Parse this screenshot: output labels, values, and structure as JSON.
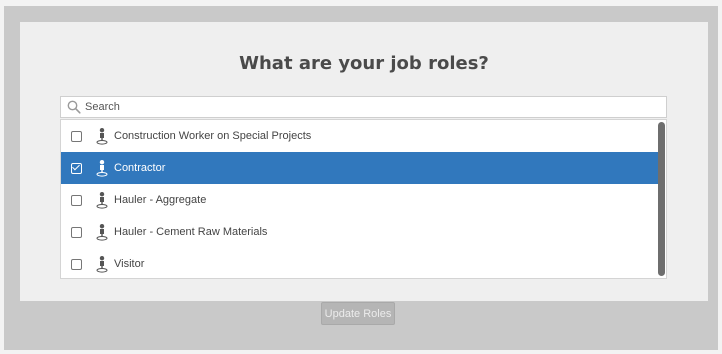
{
  "dialog": {
    "title": "What are your job roles?"
  },
  "search": {
    "placeholder": "Search",
    "value": ""
  },
  "roles": [
    {
      "label": "Construction Worker on Special Projects",
      "checked": false
    },
    {
      "label": "Contractor",
      "checked": true
    },
    {
      "label": "Hauler - Aggregate",
      "checked": false
    },
    {
      "label": "Hauler - Cement Raw Materials",
      "checked": false
    },
    {
      "label": "Visitor",
      "checked": false
    }
  ],
  "footer": {
    "update_label": "Update Roles",
    "update_enabled": false
  },
  "icons": {
    "search": "search-icon",
    "role": "map-pin-person-icon",
    "check": "checkmark-icon"
  },
  "colors": {
    "selected_row": "#3178bd",
    "panel": "#efefef",
    "frame": "#c9c9c9",
    "button_disabled": "#b5b5b5"
  }
}
